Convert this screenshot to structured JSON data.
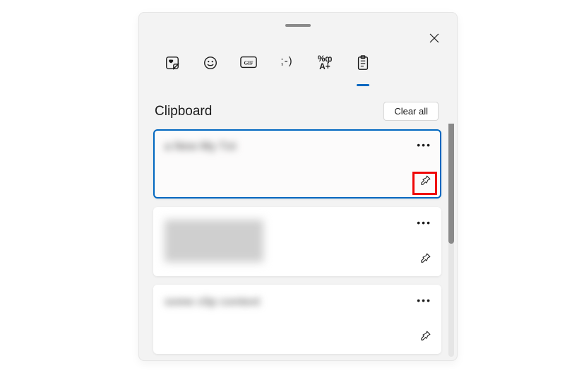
{
  "title": "Clipboard",
  "clear_label": "Clear all",
  "tabs": {
    "recent": "Recent",
    "emoji": "Emoji",
    "gif": "GIF",
    "kaomoji": ";-)",
    "symbols_line1": "%ჶ",
    "symbols_line2": "A+",
    "clipboard": "Clipboard"
  },
  "items": [
    {
      "type": "text",
      "preview": "a New My Txt"
    },
    {
      "type": "image",
      "preview": "image"
    },
    {
      "type": "text",
      "preview": "some clip context"
    }
  ]
}
